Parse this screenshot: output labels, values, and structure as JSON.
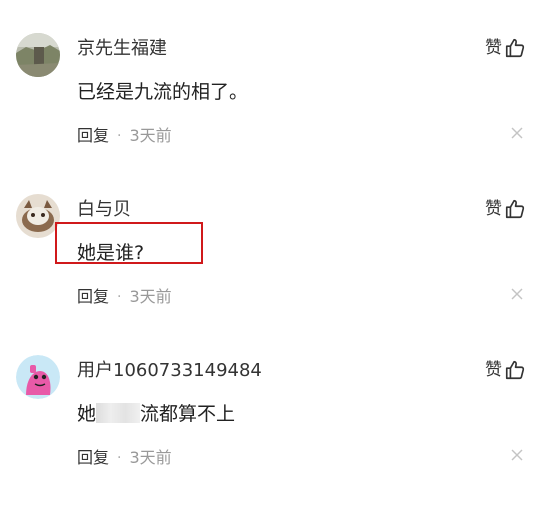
{
  "comments": [
    {
      "username": "京先生福建",
      "text": "已经是九流的相了。",
      "like_label": "赞",
      "reply_label": "回复",
      "separator": "·",
      "time": "3天前",
      "avatar_icon": "landscape-avatar"
    },
    {
      "username": "白与贝",
      "text": "她是谁?",
      "like_label": "赞",
      "reply_label": "回复",
      "separator": "·",
      "time": "3天前",
      "avatar_icon": "cat-avatar"
    },
    {
      "username": "用户1060733149484",
      "text_before": "她",
      "text_after": "流都算不上",
      "like_label": "赞",
      "reply_label": "回复",
      "separator": "·",
      "time": "3天前",
      "avatar_icon": "cartoon-avatar"
    }
  ],
  "colors": {
    "highlight": "#d0191b",
    "muted": "#999999"
  }
}
